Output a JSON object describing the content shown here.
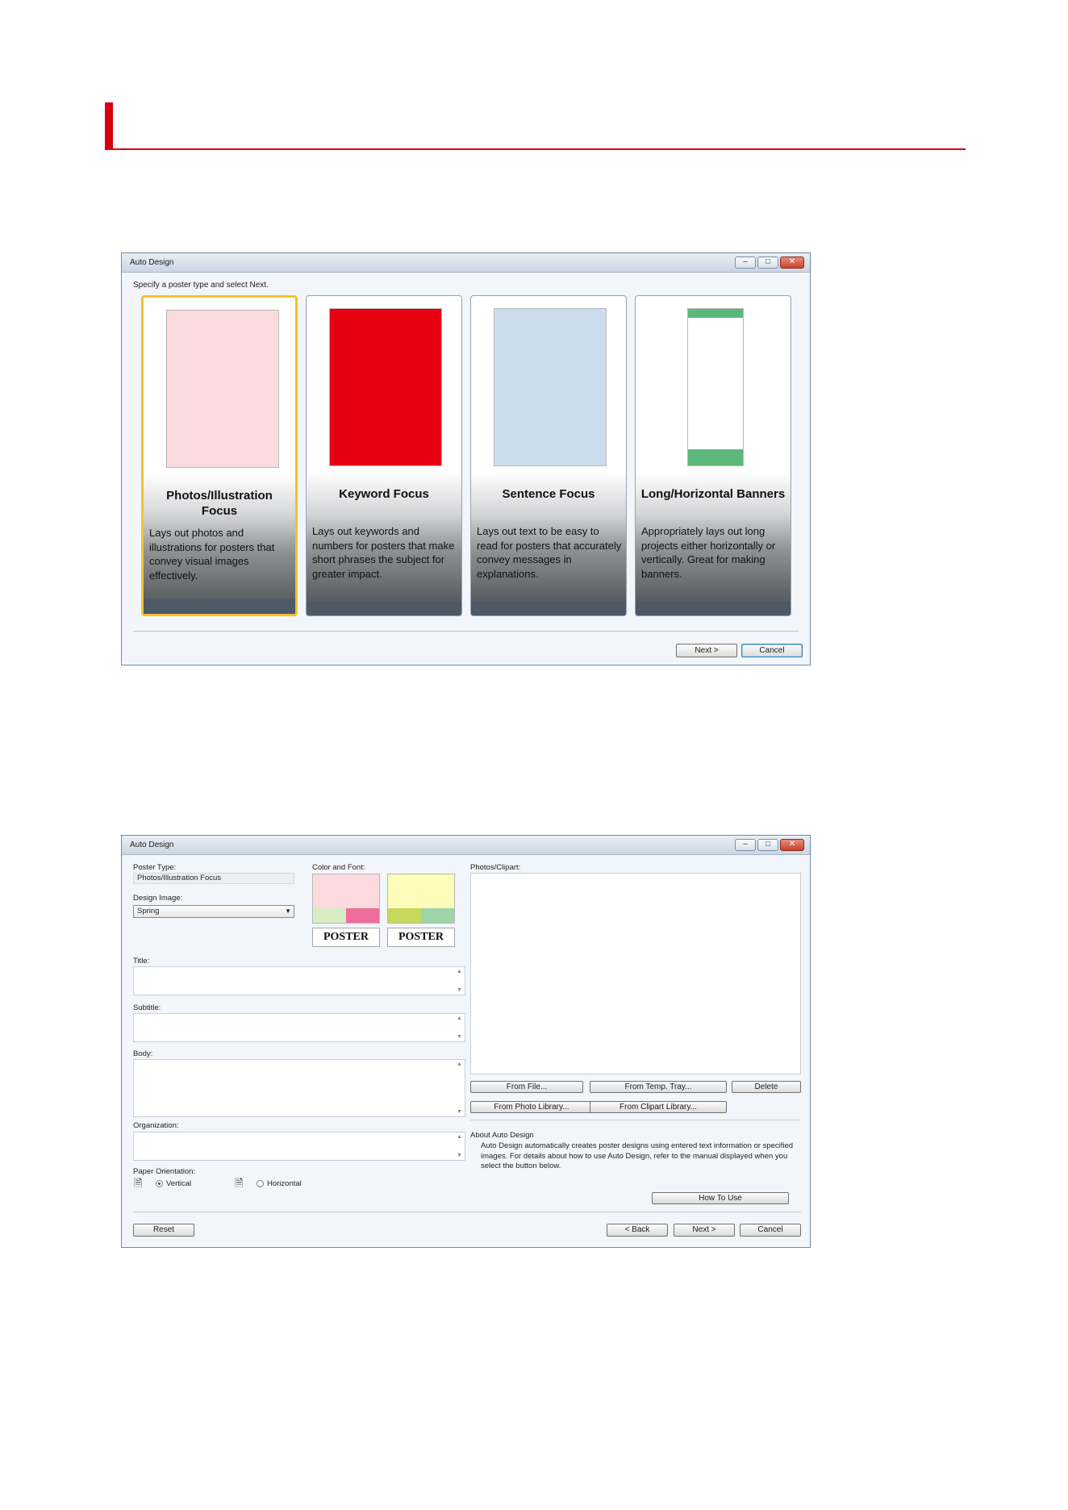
{
  "dialog1": {
    "title": "Auto Design",
    "instruction": "Specify a poster type and select Next.",
    "cards": [
      {
        "title": "Photos/Illustration Focus",
        "description": "Lays out photos and illustrations for posters that convey visual images effectively.",
        "swatch_color": "#fadadd"
      },
      {
        "title": "Keyword Focus",
        "description": "Lays out keywords and numbers for posters that make short phrases the subject for greater impact.",
        "swatch_color": "#e60012"
      },
      {
        "title": "Sentence Focus",
        "description": "Lays out text to be easy to read for posters that accurately convey messages in explanations.",
        "swatch_color": "#cddcec"
      },
      {
        "title": "Long/Horizontal Banners",
        "description": "Appropriately lays out long projects either horizontally or vertically. Great for making banners.",
        "swatch_color": "#ffffff"
      }
    ],
    "buttons": {
      "next": "Next >",
      "cancel": "Cancel"
    }
  },
  "dialog2": {
    "title": "Auto Design",
    "poster_type_label": "Poster Type:",
    "poster_type_value": "Photos/Illustration Focus",
    "design_image_label": "Design Image:",
    "design_image_value": "Spring",
    "color_font_label": "Color and Font:",
    "swatches": [
      {
        "main": "#fadadd",
        "s1": "#d9edc2",
        "s2": "#f06c9b",
        "poster_text": "POSTER"
      },
      {
        "main": "#fdfcb8",
        "s1": "#c6d95a",
        "s2": "#9ed4a8",
        "poster_text": "POSTER"
      }
    ],
    "title_label": "Title:",
    "subtitle_label": "Subtitle:",
    "body_label": "Body:",
    "organization_label": "Organization:",
    "paper_orientation_label": "Paper Orientation:",
    "orientation_vertical": "Vertical",
    "orientation_horizontal": "Horizontal",
    "photos_clipart_label": "Photos/Clipart:",
    "btn_from_file": "From File...",
    "btn_from_temp_tray": "From Temp. Tray...",
    "btn_delete": "Delete",
    "btn_from_photo_library": "From Photo Library...",
    "btn_from_clipart_library": "From Clipart Library...",
    "about_heading": "About Auto Design",
    "about_text": "Auto Design automatically creates poster designs using entered text information or specified images. For details about how to use Auto Design, refer to the manual displayed when you select the button below.",
    "btn_how_to_use": "How To Use",
    "btn_reset": "Reset",
    "btn_back": "< Back",
    "btn_next": "Next >",
    "btn_cancel": "Cancel"
  },
  "colors": {
    "accent_red": "#d6000f",
    "selected_card_border": "#f2c230"
  }
}
